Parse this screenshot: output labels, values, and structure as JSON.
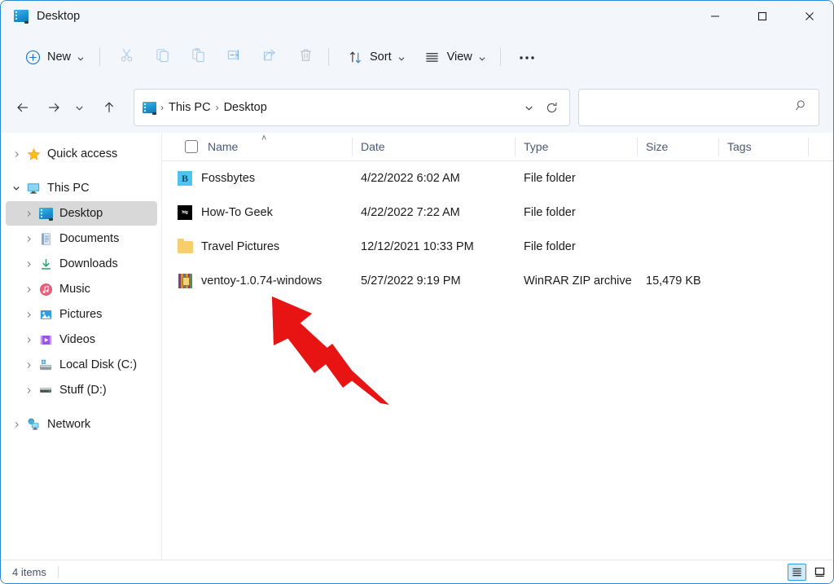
{
  "window": {
    "title": "Desktop",
    "title_icon": "desktop-icon",
    "controls": {
      "minimize": "minimize-icon",
      "maximize": "maximize-icon",
      "close": "close-icon"
    },
    "accent_color": "#2b87d4",
    "chrome_background": "#f3f6fb"
  },
  "toolbar": {
    "new_label": "New",
    "sort_label": "Sort",
    "view_label": "View",
    "items": [
      {
        "name": "new-button",
        "icon": "plus-circle-icon",
        "label": "New",
        "has_caret": true,
        "enabled": true
      },
      {
        "name": "cut-button",
        "icon": "scissors-icon",
        "label": "Cut",
        "enabled": false
      },
      {
        "name": "copy-button",
        "icon": "copy-icon",
        "label": "Copy",
        "enabled": false
      },
      {
        "name": "paste-button",
        "icon": "clipboard-icon",
        "label": "Paste",
        "enabled": false
      },
      {
        "name": "rename-button",
        "icon": "rename-icon",
        "label": "Rename",
        "enabled": false
      },
      {
        "name": "share-button",
        "icon": "share-icon",
        "label": "Share",
        "enabled": false
      },
      {
        "name": "delete-button",
        "icon": "trash-icon",
        "label": "Delete",
        "enabled": false
      },
      {
        "name": "sort-button",
        "icon": "sort-arrows-icon",
        "label": "Sort",
        "has_caret": true,
        "enabled": true
      },
      {
        "name": "view-button",
        "icon": "hamburger-icon",
        "label": "View",
        "has_caret": true,
        "enabled": true
      },
      {
        "name": "more-button",
        "icon": "ellipsis-icon",
        "label": "See more",
        "enabled": true
      }
    ]
  },
  "navigation": {
    "back": "back-arrow-icon",
    "forward": "forward-arrow-icon",
    "recent": "recent-locations-icon",
    "up": "up-arrow-icon",
    "refresh": "refresh-icon",
    "dropdown": "previous-locations-icon"
  },
  "address": {
    "icon": "desktop-icon",
    "crumbs": [
      "This PC",
      "Desktop"
    ],
    "separator": "›"
  },
  "search": {
    "placeholder": "",
    "value": "",
    "icon": "search-icon"
  },
  "sidebar": {
    "items": [
      {
        "label": "Quick access",
        "icon": "star-icon",
        "expanded": false,
        "indent": 0,
        "selected": false
      },
      {
        "label": "This PC",
        "icon": "monitor-icon",
        "expanded": true,
        "indent": 0,
        "selected": false
      },
      {
        "label": "Desktop",
        "icon": "desktop-icon",
        "expanded": false,
        "indent": 1,
        "selected": true
      },
      {
        "label": "Documents",
        "icon": "documents-icon",
        "expanded": false,
        "indent": 1,
        "selected": false
      },
      {
        "label": "Downloads",
        "icon": "download-icon",
        "expanded": false,
        "indent": 1,
        "selected": false
      },
      {
        "label": "Music",
        "icon": "music-icon",
        "expanded": false,
        "indent": 1,
        "selected": false
      },
      {
        "label": "Pictures",
        "icon": "pictures-icon",
        "expanded": false,
        "indent": 1,
        "selected": false
      },
      {
        "label": "Videos",
        "icon": "videos-icon",
        "expanded": false,
        "indent": 1,
        "selected": false
      },
      {
        "label": "Local Disk (C:)",
        "icon": "harddrive-system-icon",
        "expanded": false,
        "indent": 1,
        "selected": false
      },
      {
        "label": "Stuff (D:)",
        "icon": "harddrive-icon",
        "expanded": false,
        "indent": 1,
        "selected": false
      },
      {
        "label": "Network",
        "icon": "network-icon",
        "expanded": false,
        "indent": 0,
        "selected": false
      }
    ]
  },
  "file_list": {
    "columns": [
      {
        "label": "Name",
        "sorted": true,
        "sort_direction": "ascending",
        "sort_glyph": "˄"
      },
      {
        "label": "Date",
        "sorted": false
      },
      {
        "label": "Type",
        "sorted": false
      },
      {
        "label": "Size",
        "sorted": false
      },
      {
        "label": "Tags",
        "sorted": false
      }
    ],
    "select_all_checkbox": false,
    "rows": [
      {
        "name": "Fossbytes",
        "date": "4/22/2022 6:02 AM",
        "type": "File folder",
        "size": "",
        "tags": "",
        "icon": "fossbytes-folder-icon"
      },
      {
        "name": "How-To Geek",
        "date": "4/22/2022 7:22 AM",
        "type": "File folder",
        "size": "",
        "tags": "",
        "icon": "howtogeek-folder-icon"
      },
      {
        "name": "Travel Pictures",
        "date": "12/12/2021 10:33 PM",
        "type": "File folder",
        "size": "",
        "tags": "",
        "icon": "folder-icon"
      },
      {
        "name": "ventoy-1.0.74-windows",
        "date": "5/27/2022 9:19 PM",
        "type": "WinRAR ZIP archive",
        "size": "15,479 KB",
        "tags": "",
        "icon": "winrar-archive-icon"
      }
    ]
  },
  "annotation": {
    "type": "arrow",
    "color": "#e81414",
    "points_to": "ventoy-1.0.74-windows"
  },
  "statusbar": {
    "item_count": "4 items",
    "views": [
      {
        "name": "details-view-toggle",
        "icon": "list-lines-icon",
        "active": true
      },
      {
        "name": "large-icons-view-toggle",
        "icon": "large-icon-tile-icon",
        "active": false
      }
    ]
  }
}
